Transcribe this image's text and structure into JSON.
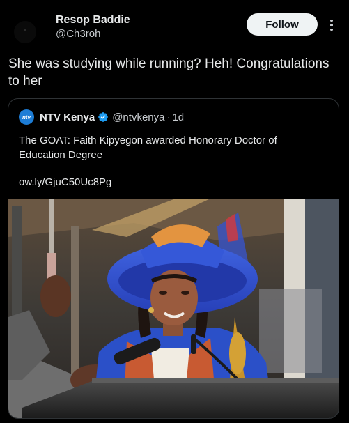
{
  "tweet": {
    "author_name": "Resop Baddie",
    "author_handle": "@Ch3roh",
    "follow_label": "Follow",
    "more_icon": "more-vertical-icon",
    "text": "She was studying while running? Heh! Congratulations to her"
  },
  "quoted": {
    "logo_text": "ntv",
    "author_name": "NTV Kenya",
    "verified_icon": "verified-badge-icon",
    "author_handle": "@ntvkenya",
    "separator": "·",
    "time": "1d",
    "text": "The GOAT: Faith Kipyegon awarded Honorary Doctor of Education Degree",
    "link": "ow.ly/GjuC50Uc8Pg",
    "image": "photo of a woman in a blue academic hat and gown speaking at a podium"
  },
  "colors": {
    "background": "#000000",
    "text": "#e7e9ea",
    "follow_bg": "#eff3f4",
    "verified": "#1d9bf0",
    "border": "#2f3336"
  }
}
